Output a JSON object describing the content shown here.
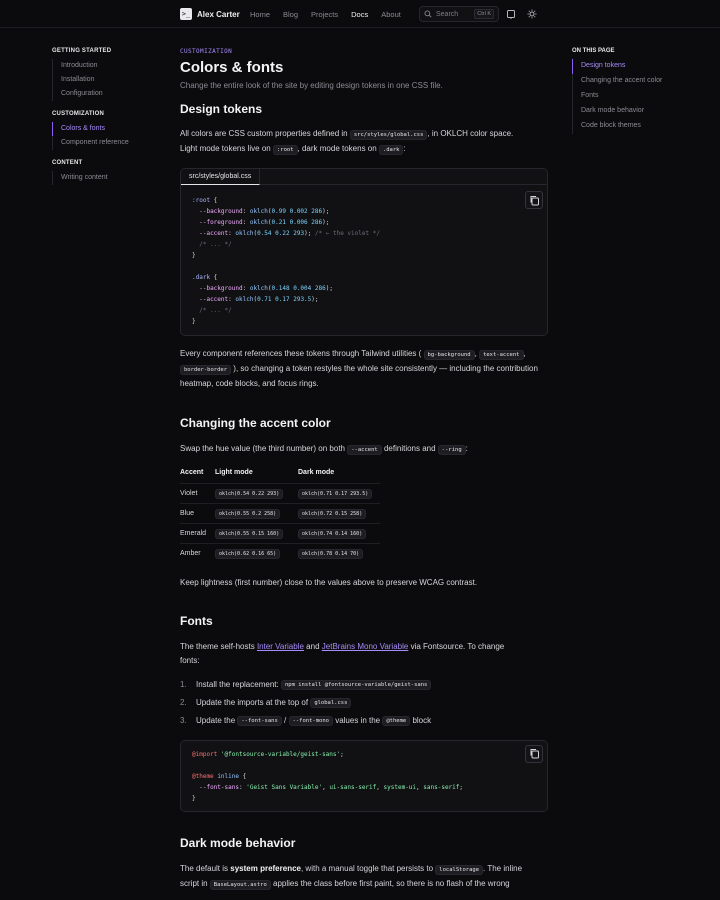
{
  "header": {
    "brand_logo": ">_",
    "brand_name": "Alex Carter",
    "nav": [
      "Home",
      "Blog",
      "Projects",
      "Docs",
      "About"
    ],
    "active_nav": "Docs",
    "search_placeholder": "Search",
    "search_shortcut": "Ctrl K",
    "icons": [
      "terminal-icon",
      "search-icon",
      "rss-icon",
      "sun-icon"
    ]
  },
  "sidebar": {
    "sections": [
      {
        "title": "GETTING STARTED",
        "items": [
          "Introduction",
          "Installation",
          "Configuration"
        ]
      },
      {
        "title": "CUSTOMIZATION",
        "items": [
          "Colors & fonts",
          "Component reference"
        ]
      },
      {
        "title": "CONTENT",
        "items": [
          "Writing content"
        ]
      }
    ],
    "active_item": "Colors & fonts"
  },
  "toc": {
    "title": "ON THIS PAGE",
    "items": [
      "Design tokens",
      "Changing the accent color",
      "Fonts",
      "Dark mode behavior",
      "Code block themes"
    ],
    "active_item": "Design tokens"
  },
  "page": {
    "eyebrow": "CUSTOMIZATION",
    "title": "Colors & fonts",
    "lead": "Change the entire look of the site by editing design tokens in one CSS file.",
    "design_tokens": {
      "heading": "Design tokens",
      "p1_a": "All colors are CSS custom properties defined in",
      "p1_code1": "src/styles/global.css",
      "p1_b": ", in OKLCH color space.",
      "p1_c": "Light mode tokens live on",
      "p1_code2": ":root",
      "p1_d": ", dark mode tokens on",
      "p1_code3": ".dark",
      "p1_e": ":",
      "code_tab": "src/styles/global.css",
      "p2_a": "Every component references these tokens through Tailwind utilities (",
      "p2_code1": "bg-background",
      "p2_sep1": ",",
      "p2_code2": "text-accent",
      "p2_sep2": ",",
      "p2_code3": "border-border",
      "p2_b": "), so changing a token restyles the whole site consistently — including",
      "p2_c": "the contribution heatmap, code blocks, and focus rings."
    },
    "accent": {
      "heading": "Changing the accent color",
      "p_a": "Swap the hue value (the third number) on both",
      "p_code1": "--accent",
      "p_b": "definitions and",
      "p_code2": "--ring",
      "p_c": ":",
      "table_headers": [
        "Accent",
        "Light mode",
        "Dark mode"
      ],
      "table_rows": [
        [
          "Violet",
          "oklch(0.54 0.22 293)",
          "oklch(0.71 0.17 293.5)"
        ],
        [
          "Blue",
          "oklch(0.55 0.2 258)",
          "oklch(0.72 0.15 258)"
        ],
        [
          "Emerald",
          "oklch(0.55 0.15 160)",
          "oklch(0.74 0.14 160)"
        ],
        [
          "Amber",
          "oklch(0.62 0.16 65)",
          "oklch(0.78 0.14 70)"
        ]
      ],
      "after": "Keep lightness (first number) close to the values above to preserve WCAG contrast."
    },
    "fonts": {
      "heading": "Fonts",
      "p_a": "The theme self-hosts",
      "link1": "Inter Variable",
      "p_and": "and",
      "link2": "JetBrains Mono Variable",
      "p_b": "via Fontsource. To change",
      "p_c": "fonts:",
      "steps": [
        {
          "num": "1.",
          "text": "Install the replacement:",
          "code": "npm install @fontsource-variable/geist-sans"
        },
        {
          "num": "2.",
          "text": "Update the imports at the top of",
          "code": "global.css"
        },
        {
          "num": "3.",
          "text": "Update the",
          "code": "--font-sans",
          "slash": "/",
          "code2": "--font-mono",
          "text2": "values in the",
          "code3": "@theme",
          "text3": "block"
        }
      ]
    },
    "dark_mode": {
      "heading": "Dark mode behavior",
      "p_a": "The default is",
      "p_bold": "system preference",
      "p_b": ", with a manual toggle that persists to",
      "p_code": "localStorage",
      "p_c": ". The inline",
      "p_d": "script in",
      "p_code2": "BaseLayout.astro",
      "p_e": "applies the class before first paint, so there is no flash of the wrong"
    }
  },
  "code1_lines": [
    ":root {",
    "  --background: oklch(0.99 0.002 286);",
    "  --foreground: oklch(0.21 0.006 286);",
    "  --accent: oklch(0.54 0.22 293); /* ← the violet */",
    "  /* ... */",
    "}",
    "",
    ".dark {",
    "  --background: oklch(0.148 0.004 286);",
    "  --accent: oklch(0.71 0.17 293.5);",
    "  /* ... */",
    "}"
  ],
  "code2_lines": [
    "@import '@fontsource-variable/geist-sans';",
    "",
    "@theme inline {",
    "  --font-sans: 'Geist Sans Variable', ui-sans-serif, system-ui, sans-serif;",
    "}"
  ],
  "colors": {
    "accent": "#a78bfa",
    "background": "#0b0b0d",
    "panel": "#111114"
  }
}
